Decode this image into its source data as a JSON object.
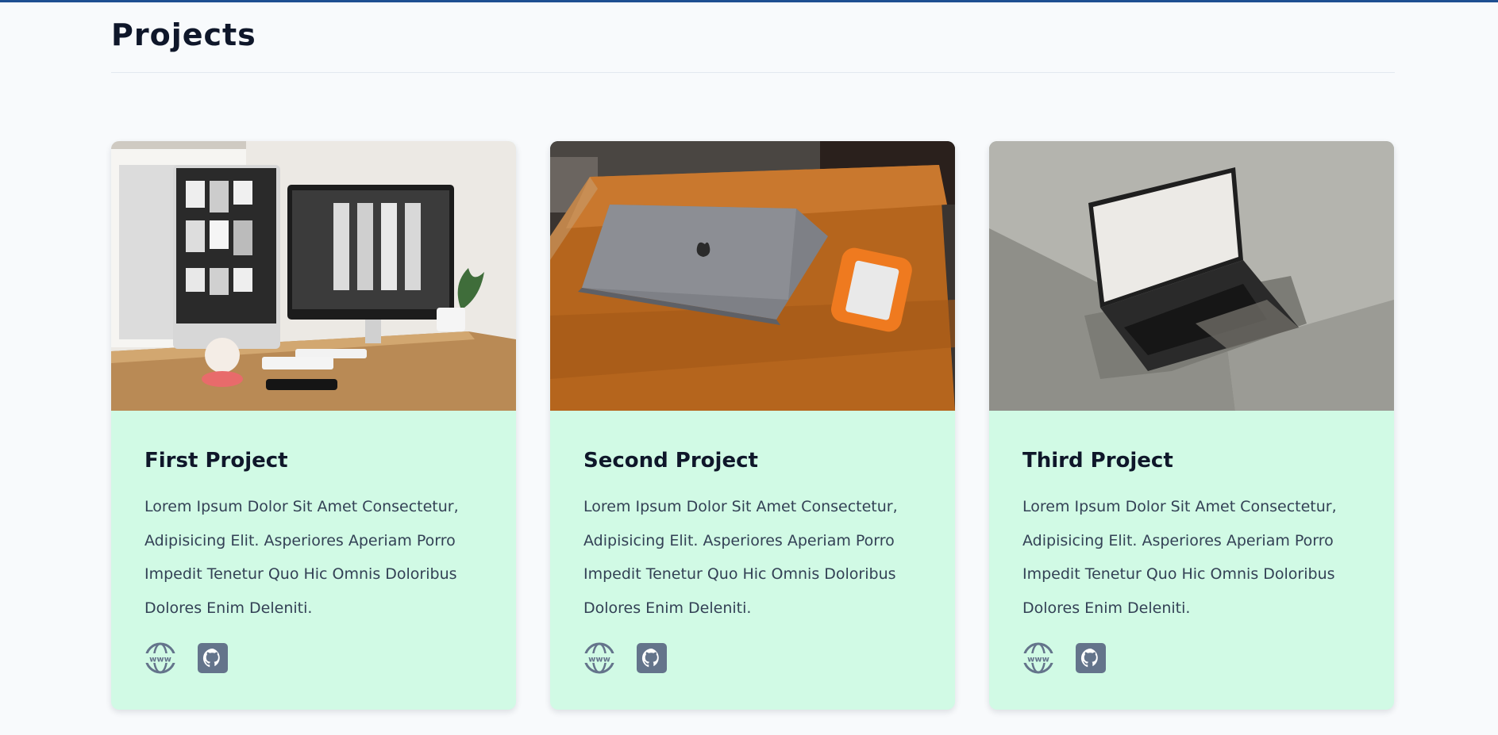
{
  "page": {
    "title": "Projects"
  },
  "colors": {
    "accent_bar": "#1e4f91",
    "card_bg": "#d1fae5",
    "icon": "#64748b"
  },
  "projects": [
    {
      "title": "First Project",
      "description": "Lorem Ipsum Dolor Sit Amet Consectetur, Adipisicing Elit. Asperiores Aperiam Porro Impedit Tenetur Quo Hic Omnis Doloribus Dolores Enim Deleniti.",
      "image": "desk-with-two-monitors-photo",
      "links": [
        "www-globe-icon",
        "github-icon"
      ]
    },
    {
      "title": "Second Project",
      "description": "Lorem Ipsum Dolor Sit Amet Consectetur, Adipisicing Elit. Asperiores Aperiam Porro Impedit Tenetur Quo Hic Omnis Doloribus Dolores Enim Deleniti.",
      "image": "laptop-and-orange-drive-on-wood-table-photo",
      "links": [
        "www-globe-icon",
        "github-icon"
      ]
    },
    {
      "title": "Third Project",
      "description": "Lorem Ipsum Dolor Sit Amet Consectetur, Adipisicing Elit. Asperiores Aperiam Porro Impedit Tenetur Quo Hic Omnis Doloribus Dolores Enim Deleniti.",
      "image": "open-laptop-on-grey-block-photo",
      "links": [
        "www-globe-icon",
        "github-icon"
      ]
    }
  ]
}
